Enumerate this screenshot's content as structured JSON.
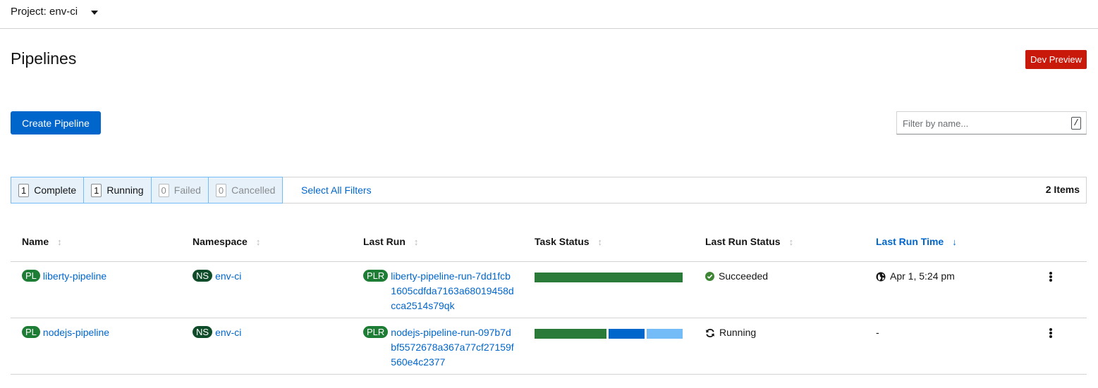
{
  "project": {
    "label": "Project: env-ci"
  },
  "page": {
    "title": "Pipelines",
    "badge": "Dev Preview"
  },
  "toolbar": {
    "create_label": "Create Pipeline",
    "filter_placeholder": "Filter by name...",
    "filter_value": "",
    "filter_shortcut": "/"
  },
  "filters": {
    "chips": [
      {
        "count": "1",
        "label": "Complete"
      },
      {
        "count": "1",
        "label": "Running"
      },
      {
        "count": "0",
        "label": "Failed"
      },
      {
        "count": "0",
        "label": "Cancelled"
      }
    ],
    "select_all": "Select All Filters",
    "items": "2 Items"
  },
  "table": {
    "headers": [
      "Name",
      "Namespace",
      "Last Run",
      "Task Status",
      "Last Run Status",
      "Last Run Time"
    ],
    "rows": [
      {
        "name_badge": "PL",
        "name": "liberty-pipeline",
        "ns_badge": "NS",
        "namespace": "env-ci",
        "run_badge": "PLR",
        "last_run": "liberty-pipeline-run-7dd1fcb1605cdfda7163a68019458dcca2514s79qk",
        "task_status": [
          {
            "fraction": 1.0,
            "color": "#2a7a3a"
          }
        ],
        "status": "Succeeded",
        "status_icon": "check-circle-icon",
        "time_icon": "globe-icon",
        "time": "Apr 1, 5:24 pm"
      },
      {
        "name_badge": "PL",
        "name": "nodejs-pipeline",
        "ns_badge": "NS",
        "namespace": "env-ci",
        "run_badge": "PLR",
        "last_run": "nodejs-pipeline-run-097b7dbf5572678a367a77cf27159f560e4c2377",
        "task_status": [
          {
            "fraction": 0.5,
            "color": "#2a7a3a"
          },
          {
            "fraction": 0.25,
            "color": "#0066cc"
          },
          {
            "fraction": 0.25,
            "color": "#73bcf7"
          }
        ],
        "status": "Running",
        "status_icon": "sync-icon",
        "time_icon": "",
        "time": "-"
      }
    ]
  }
}
